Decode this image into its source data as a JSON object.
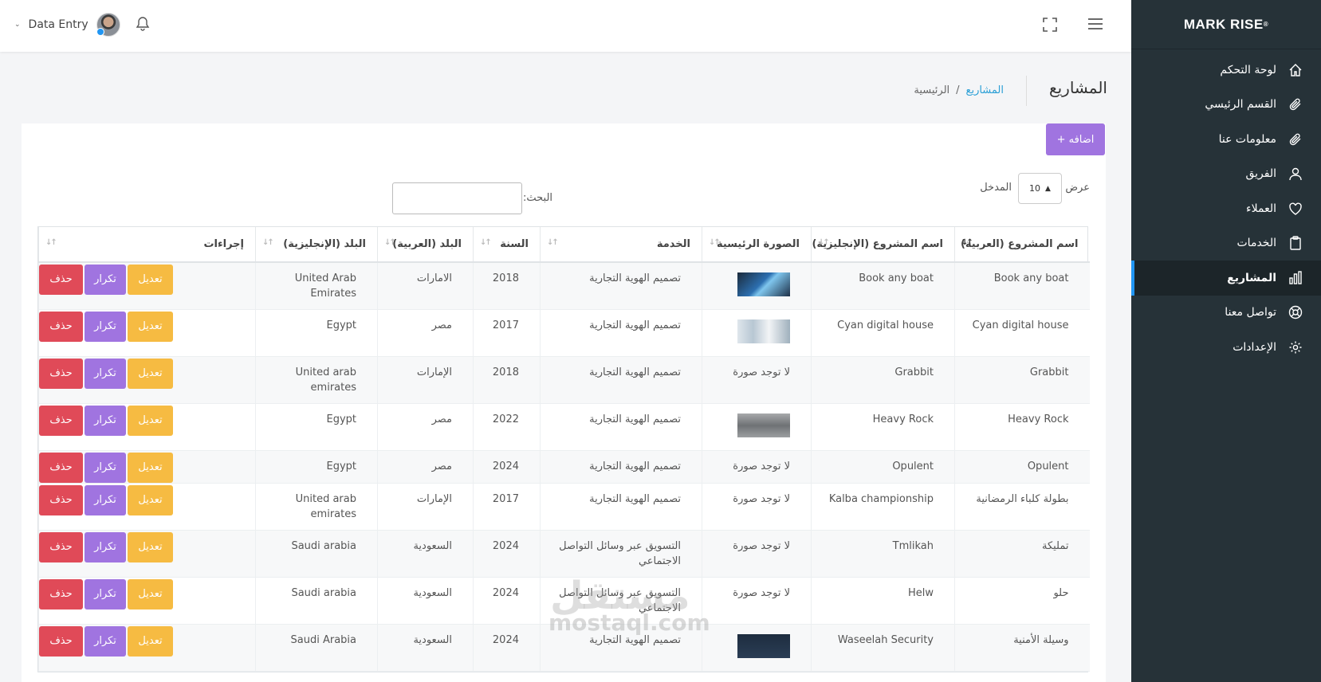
{
  "sidebar": {
    "brand": "MARK RISE",
    "items": [
      {
        "label": "لوحة التحكم",
        "icon": "home-icon"
      },
      {
        "label": "القسم الرئيسي",
        "icon": "paperclip-icon"
      },
      {
        "label": "معلومات عنا",
        "icon": "paperclip-icon"
      },
      {
        "label": "الفريق",
        "icon": "user-icon"
      },
      {
        "label": "العملاء",
        "icon": "heart-icon"
      },
      {
        "label": "الخدمات",
        "icon": "clipboard-icon"
      },
      {
        "label": "المشاريع",
        "icon": "bar-chart-icon",
        "active": true
      },
      {
        "label": "تواصل معنا",
        "icon": "lifebuoy-icon"
      },
      {
        "label": "الإعدادات",
        "icon": "gear-icon"
      }
    ]
  },
  "topbar": {
    "user_name": "Data Entry"
  },
  "page": {
    "title": "المشاريع",
    "breadcrumb_home": "الرئيسية",
    "breadcrumb_sep": "/",
    "breadcrumb_current": "المشاريع"
  },
  "controls": {
    "add_button": "اضافه +",
    "show_label": "عرض",
    "page_length": "10",
    "entries_label": "المدخل",
    "search_label": "البحث:"
  },
  "table": {
    "headers": [
      "اسم المشروع (العربية)",
      "اسم المشروع (الإنجليزية)",
      "الصورة الرئيسية",
      "الخدمة",
      "السنة",
      "البلد (العربية)",
      "البلد (الإنجليزية)",
      "إجراءات"
    ],
    "buttons": {
      "edit": "تعديل",
      "duplicate": "تكرار",
      "delete": "حذف"
    },
    "rows": [
      {
        "name_ar": "Book any boat",
        "name_en": "Book any boat",
        "image": "thumb-blue",
        "service": "تصميم الهوية التجارية",
        "year": "2018",
        "country_ar": "الامارات",
        "country_en": "United Arab Emirates"
      },
      {
        "name_ar": "Cyan digital house",
        "name_en": "Cyan digital house",
        "image": "thumb-office",
        "service": "تصميم الهوية التجارية",
        "year": "2017",
        "country_ar": "مصر",
        "country_en": "Egypt"
      },
      {
        "name_ar": "Grabbit",
        "name_en": "Grabbit",
        "image": "لا توجد صورة",
        "service": "تصميم الهوية التجارية",
        "year": "2018",
        "country_ar": "الإمارات",
        "country_en": "United arab emirates"
      },
      {
        "name_ar": "Heavy Rock",
        "name_en": "Heavy Rock",
        "image": "thumb-gray",
        "service": "تصميم الهوية التجارية",
        "year": "2022",
        "country_ar": "مصر",
        "country_en": "Egypt"
      },
      {
        "name_ar": "Opulent",
        "name_en": "Opulent",
        "image": "لا توجد صورة",
        "service": "تصميم الهوية التجارية",
        "year": "2024",
        "country_ar": "مصر",
        "country_en": "Egypt"
      },
      {
        "name_ar": "بطولة كلباء الرمضانية",
        "name_en": "Kalba championship",
        "image": "لا توجد صورة",
        "service": "تصميم الهوية التجارية",
        "year": "2017",
        "country_ar": "الإمارات",
        "country_en": "United arab emirates"
      },
      {
        "name_ar": "تمليكة",
        "name_en": "Tmlikah",
        "image": "لا توجد صورة",
        "service": "التسويق عبر وسائل التواصل الاجتماعي",
        "year": "2024",
        "country_ar": "السعودية",
        "country_en": "Saudi arabia"
      },
      {
        "name_ar": "حلو",
        "name_en": "Helw",
        "image": "لا توجد صورة",
        "service": "التسويق عبر وسائل التواصل الاجتماعي",
        "year": "2024",
        "country_ar": "السعودية",
        "country_en": "Saudi arabia"
      },
      {
        "name_ar": "وسيلة الأمنية",
        "name_en": "Waseelah Security",
        "image": "thumb-dark",
        "service": "تصميم الهوية التجارية",
        "year": "2024",
        "country_ar": "السعودية",
        "country_en": "Saudi Arabia"
      }
    ]
  },
  "watermark": {
    "line1": "مستقل",
    "line2": "mostaql.com"
  }
}
